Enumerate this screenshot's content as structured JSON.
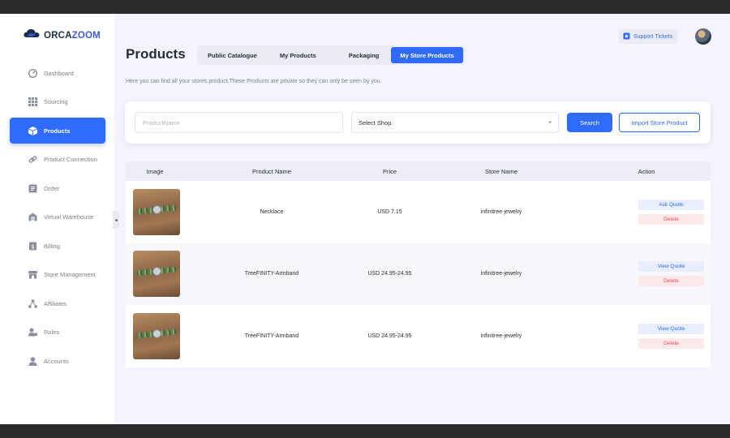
{
  "brand": {
    "logo_part1": "ORCA",
    "logo_part2": "ZOOM"
  },
  "sidebar": {
    "items": [
      {
        "label": "Dashboard",
        "icon": "dashboard-icon",
        "active": false
      },
      {
        "label": "Sourcing",
        "icon": "grid-icon",
        "active": false
      },
      {
        "label": "Products",
        "icon": "box-icon",
        "active": true
      },
      {
        "label": "Product Connection",
        "icon": "link-icon",
        "active": false
      },
      {
        "label": "Order",
        "icon": "order-icon",
        "active": false
      },
      {
        "label": "Virtual Warehouse",
        "icon": "warehouse-icon",
        "active": false
      },
      {
        "label": "Billing",
        "icon": "billing-icon",
        "active": false
      },
      {
        "label": "Store Management",
        "icon": "store-icon",
        "active": false
      },
      {
        "label": "Affiliates",
        "icon": "affiliates-icon",
        "active": false
      },
      {
        "label": "Roles",
        "icon": "roles-icon",
        "active": false
      },
      {
        "label": "Accounts",
        "icon": "account-icon",
        "active": false
      }
    ]
  },
  "header": {
    "title": "Products",
    "subtitle": "Here you can find all your stores product.These Products are private so they can only be seen by you.",
    "support_label": "Support Tickets"
  },
  "tabs": [
    {
      "label": "Public Catalogue",
      "active": false
    },
    {
      "label": "My Products",
      "active": false
    },
    {
      "label": "Packaging",
      "active": false
    },
    {
      "label": "My Store Products",
      "active": true
    }
  ],
  "search": {
    "placeholder": "ProductName",
    "value": "",
    "select_value": "Select Shop",
    "search_label": "Search",
    "import_label": "Import Store Product"
  },
  "table": {
    "headers": [
      "Image",
      "Product Name",
      "Price",
      "Store Name",
      "Action"
    ],
    "rows": [
      {
        "name": "Necklace",
        "price": "USD 7.15",
        "store": "infinitree-jewelry",
        "action_primary": "Ask Quote",
        "action_delete": "Delete"
      },
      {
        "name": "TreeFINITY-Armband",
        "price": "USD 24.95-24.95",
        "store": "infinitree-jewelry",
        "action_primary": "View Quote",
        "action_delete": "Delete"
      },
      {
        "name": "TreeFINITY-Armband",
        "price": "USD 24.95-24.95",
        "store": "infinitree-jewelry",
        "action_primary": "View Quote",
        "action_delete": "Delete"
      }
    ]
  },
  "colors": {
    "accent": "#2f6bff",
    "delete": "#f04b55",
    "background": "#f4f4fc"
  }
}
